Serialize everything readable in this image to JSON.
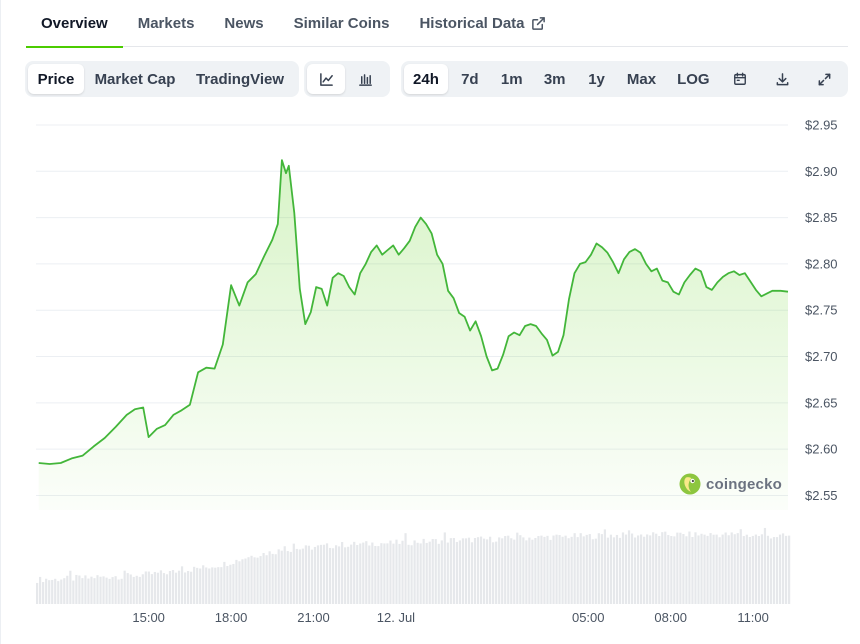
{
  "tabs": [
    {
      "label": "Overview"
    },
    {
      "label": "Markets"
    },
    {
      "label": "News"
    },
    {
      "label": "Similar Coins"
    },
    {
      "label": "Historical Data"
    }
  ],
  "toolbar": {
    "metric": [
      "Price",
      "Market Cap",
      "TradingView"
    ],
    "chart_style_icons": [
      "line-chart-icon",
      "candlestick-chart-icon"
    ],
    "ranges": [
      "24h",
      "7d",
      "1m",
      "3m",
      "1y",
      "Max",
      "LOG"
    ],
    "action_icons": [
      "calendar-icon",
      "download-icon",
      "expand-icon"
    ],
    "selected_metric": "Price",
    "selected_range": "24h"
  },
  "watermark": "coingecko",
  "colors": {
    "line": "#43b63a",
    "volume": "#e6e8eb",
    "grid": "#eceff3",
    "accent": "#4bcc00"
  },
  "chart_data": {
    "type": "area",
    "y_tick_labels": [
      "$2.95",
      "$2.90",
      "$2.85",
      "$2.80",
      "$2.75",
      "$2.70",
      "$2.65",
      "$2.60",
      "$2.55"
    ],
    "y_ticks": [
      2.95,
      2.9,
      2.85,
      2.8,
      2.75,
      2.7,
      2.65,
      2.6,
      2.55
    ],
    "ylim": [
      2.5343,
      2.9662
    ],
    "x_tick_labels": [
      "15:00",
      "18:00",
      "21:00",
      "12. Jul",
      "05:00",
      "08:00",
      "11:00"
    ],
    "x_ticks": [
      13.0,
      16.0,
      19.0,
      22.0,
      29.0,
      32.0,
      35.0
    ],
    "xlim": [
      8.9,
      36.27
    ],
    "x_unit": "hours from 00:00 on the day before 12. Jul",
    "grid": true,
    "price": [
      [
        9.0,
        2.585
      ],
      [
        9.4,
        2.584
      ],
      [
        9.8,
        2.585
      ],
      [
        10.2,
        2.59
      ],
      [
        10.6,
        2.593
      ],
      [
        11.0,
        2.603
      ],
      [
        11.4,
        2.612
      ],
      [
        11.8,
        2.624
      ],
      [
        12.2,
        2.637
      ],
      [
        12.5,
        2.643
      ],
      [
        12.8,
        2.645
      ],
      [
        13.0,
        2.613
      ],
      [
        13.3,
        2.622
      ],
      [
        13.6,
        2.626
      ],
      [
        13.9,
        2.637
      ],
      [
        14.2,
        2.642
      ],
      [
        14.5,
        2.648
      ],
      [
        14.8,
        2.683
      ],
      [
        15.1,
        2.688
      ],
      [
        15.4,
        2.687
      ],
      [
        15.7,
        2.713
      ],
      [
        16.0,
        2.777
      ],
      [
        16.3,
        2.755
      ],
      [
        16.6,
        2.78
      ],
      [
        16.9,
        2.789
      ],
      [
        17.2,
        2.808
      ],
      [
        17.5,
        2.826
      ],
      [
        17.7,
        2.843
      ],
      [
        17.85,
        2.912
      ],
      [
        18.0,
        2.898
      ],
      [
        18.1,
        2.906
      ],
      [
        18.3,
        2.855
      ],
      [
        18.5,
        2.773
      ],
      [
        18.7,
        2.735
      ],
      [
        18.9,
        2.748
      ],
      [
        19.1,
        2.775
      ],
      [
        19.3,
        2.773
      ],
      [
        19.5,
        2.755
      ],
      [
        19.7,
        2.785
      ],
      [
        19.9,
        2.79
      ],
      [
        20.1,
        2.787
      ],
      [
        20.3,
        2.775
      ],
      [
        20.5,
        2.767
      ],
      [
        20.7,
        2.79
      ],
      [
        20.9,
        2.8
      ],
      [
        21.1,
        2.813
      ],
      [
        21.3,
        2.82
      ],
      [
        21.5,
        2.81
      ],
      [
        21.7,
        2.815
      ],
      [
        21.9,
        2.82
      ],
      [
        22.1,
        2.81
      ],
      [
        22.3,
        2.817
      ],
      [
        22.5,
        2.825
      ],
      [
        22.7,
        2.84
      ],
      [
        22.9,
        2.85
      ],
      [
        23.1,
        2.843
      ],
      [
        23.3,
        2.833
      ],
      [
        23.5,
        2.81
      ],
      [
        23.7,
        2.8
      ],
      [
        23.9,
        2.771
      ],
      [
        24.1,
        2.763
      ],
      [
        24.3,
        2.747
      ],
      [
        24.5,
        2.743
      ],
      [
        24.7,
        2.728
      ],
      [
        24.9,
        2.738
      ],
      [
        25.1,
        2.722
      ],
      [
        25.3,
        2.7
      ],
      [
        25.5,
        2.685
      ],
      [
        25.7,
        2.687
      ],
      [
        25.9,
        2.702
      ],
      [
        26.1,
        2.722
      ],
      [
        26.3,
        2.726
      ],
      [
        26.5,
        2.723
      ],
      [
        26.7,
        2.733
      ],
      [
        26.9,
        2.735
      ],
      [
        27.1,
        2.733
      ],
      [
        27.3,
        2.725
      ],
      [
        27.5,
        2.718
      ],
      [
        27.7,
        2.701
      ],
      [
        27.9,
        2.705
      ],
      [
        28.1,
        2.723
      ],
      [
        28.3,
        2.762
      ],
      [
        28.5,
        2.79
      ],
      [
        28.7,
        2.8
      ],
      [
        28.9,
        2.802
      ],
      [
        29.1,
        2.81
      ],
      [
        29.3,
        2.822
      ],
      [
        29.5,
        2.818
      ],
      [
        29.7,
        2.812
      ],
      [
        29.9,
        2.802
      ],
      [
        30.1,
        2.79
      ],
      [
        30.3,
        2.805
      ],
      [
        30.5,
        2.813
      ],
      [
        30.7,
        2.816
      ],
      [
        30.9,
        2.812
      ],
      [
        31.1,
        2.8
      ],
      [
        31.3,
        2.792
      ],
      [
        31.5,
        2.795
      ],
      [
        31.7,
        2.782
      ],
      [
        31.9,
        2.78
      ],
      [
        32.1,
        2.77
      ],
      [
        32.3,
        2.767
      ],
      [
        32.5,
        2.78
      ],
      [
        32.7,
        2.788
      ],
      [
        32.9,
        2.795
      ],
      [
        33.1,
        2.792
      ],
      [
        33.3,
        2.775
      ],
      [
        33.5,
        2.772
      ],
      [
        33.7,
        2.78
      ],
      [
        33.9,
        2.786
      ],
      [
        34.1,
        2.79
      ],
      [
        34.3,
        2.792
      ],
      [
        34.5,
        2.788
      ],
      [
        34.7,
        2.79
      ],
      [
        34.9,
        2.781
      ],
      [
        35.1,
        2.772
      ],
      [
        35.3,
        2.765
      ],
      [
        35.5,
        2.768
      ],
      [
        35.7,
        2.771
      ],
      [
        36.0,
        2.771
      ],
      [
        36.27,
        2.77
      ]
    ],
    "volume": {
      "min_label_value": 2.5,
      "shape": [
        0.3,
        0.31,
        0.3,
        0.32,
        0.31,
        0.33,
        0.32,
        0.34,
        0.33,
        0.35,
        0.34,
        0.35,
        0.36,
        0.37,
        0.38,
        0.39,
        0.4,
        0.42,
        0.43,
        0.45,
        0.46,
        0.48,
        0.5,
        0.53,
        0.56,
        0.6,
        0.62,
        0.64,
        0.66,
        0.68,
        0.69,
        0.7,
        0.71,
        0.72,
        0.73,
        0.74,
        0.75,
        0.75,
        0.76,
        0.76,
        0.77,
        0.77,
        0.77,
        0.78,
        0.78,
        0.79,
        0.79,
        0.8,
        0.8,
        0.81,
        0.81,
        0.81,
        0.82,
        0.82,
        0.82,
        0.83,
        0.83,
        0.84,
        0.84,
        0.84,
        0.85,
        0.85,
        0.85,
        0.86,
        0.86,
        0.86,
        0.86,
        0.87,
        0.87,
        0.87,
        0.87,
        0.87,
        0.88,
        0.88,
        0.88,
        0.88,
        0.88,
        0.88,
        0.88,
        0.88,
        0.88,
        0.88,
        0.88,
        0.88,
        0.87,
        0.87,
        0.87,
        0.86,
        0.86,
        0.86
      ]
    }
  }
}
